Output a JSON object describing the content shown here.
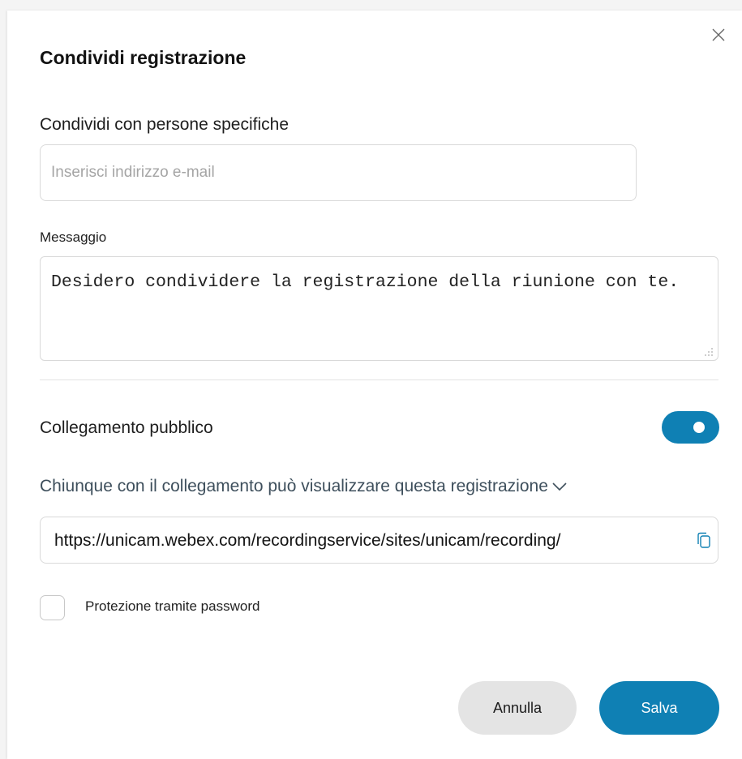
{
  "dialog": {
    "title": "Condividi registrazione",
    "close_icon": "close-icon"
  },
  "share": {
    "section_label": "Condividi con persone specifiche",
    "email_placeholder": "Inserisci indirizzo e-mail",
    "email_value": ""
  },
  "message": {
    "label": "Messaggio",
    "value": "Desidero condividere la registrazione della riunione con te."
  },
  "public_link": {
    "label": "Collegamento pubblico",
    "toggle_on": true,
    "access_option": "Chiunque con il collegamento può visualizzare questa registrazione",
    "url": "https://unicam.webex.com/recordingservice/sites/unicam/recording/",
    "copy_icon": "copy-icon",
    "chevron_icon": "chevron-down-icon"
  },
  "password": {
    "label": "Protezione tramite password",
    "checked": false
  },
  "actions": {
    "cancel_label": "Annulla",
    "save_label": "Salva"
  },
  "colors": {
    "accent": "#0f80b4",
    "cancel_bg": "#e4e4e4",
    "secondary_text": "#3e4f5c"
  }
}
